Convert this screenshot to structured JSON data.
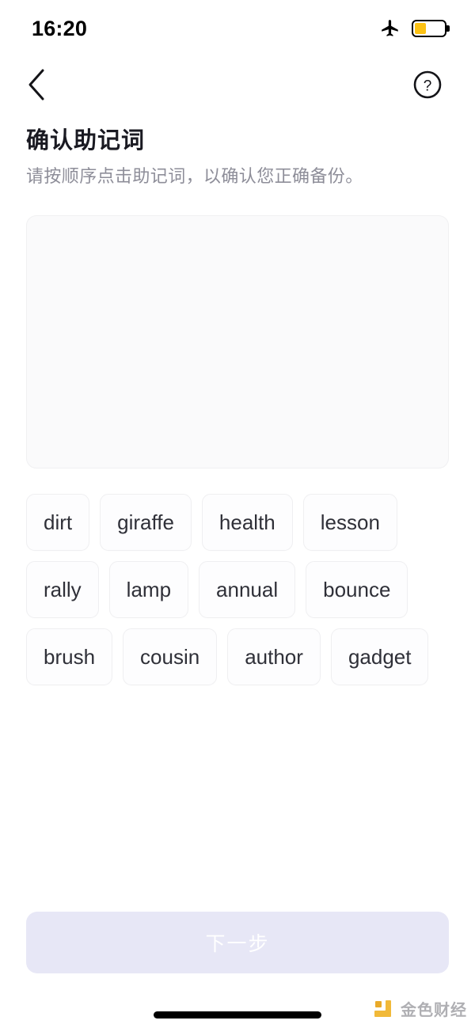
{
  "status_bar": {
    "time": "16:20",
    "airplane_icon": "airplane-mode-icon",
    "battery_icon": "battery-low-power-icon",
    "battery_level_percent": 40,
    "battery_color": "#fcc214"
  },
  "nav": {
    "back_icon": "chevron-left-icon",
    "help_icon": "question-mark-circle-icon"
  },
  "header": {
    "title": "确认助记词",
    "subtitle": "请按顺序点击助记词，以确认您正确备份。"
  },
  "answer_area": {
    "selected_words": [],
    "background_color": "#fafafb"
  },
  "word_pool": {
    "words": [
      "dirt",
      "giraffe",
      "health",
      "lesson",
      "rally",
      "lamp",
      "annual",
      "bounce",
      "brush",
      "cousin",
      "author",
      "gadget"
    ]
  },
  "footer": {
    "next_label": "下一步",
    "next_enabled": false,
    "next_bg_color": "#e7e7f6",
    "next_text_color": "#ffffff"
  },
  "watermark": {
    "text": "金色财经",
    "logo_icon": "jinse-logo-icon",
    "logo_color": "#e8a317"
  }
}
